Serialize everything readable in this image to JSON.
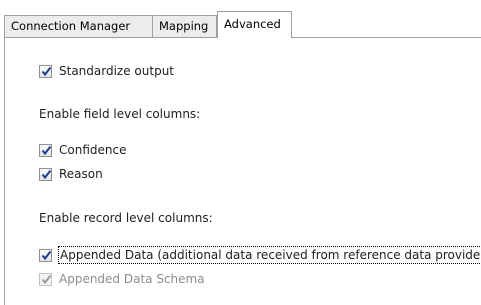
{
  "tabs": [
    {
      "label": "Connection Manager"
    },
    {
      "label": "Mapping"
    },
    {
      "label": "Advanced"
    }
  ],
  "advanced": {
    "standardize_output": {
      "label": "Standardize output",
      "checked": true
    },
    "field_section_label": "Enable field level columns:",
    "confidence": {
      "label": "Confidence",
      "checked": true
    },
    "reason": {
      "label": "Reason",
      "checked": true
    },
    "record_section_label": "Enable record level columns:",
    "appended_data": {
      "label": "Appended Data (additional data received from reference data provider)",
      "checked": true
    },
    "appended_data_schema": {
      "label": "Appended Data Schema",
      "checked": true,
      "disabled": true
    }
  },
  "colors": {
    "check": "#1b3f8f",
    "check_disabled": "#9a9a9a",
    "disabled_text": "#8d8d8d"
  },
  "icons": {
    "checkmark": "checkmark-icon"
  }
}
